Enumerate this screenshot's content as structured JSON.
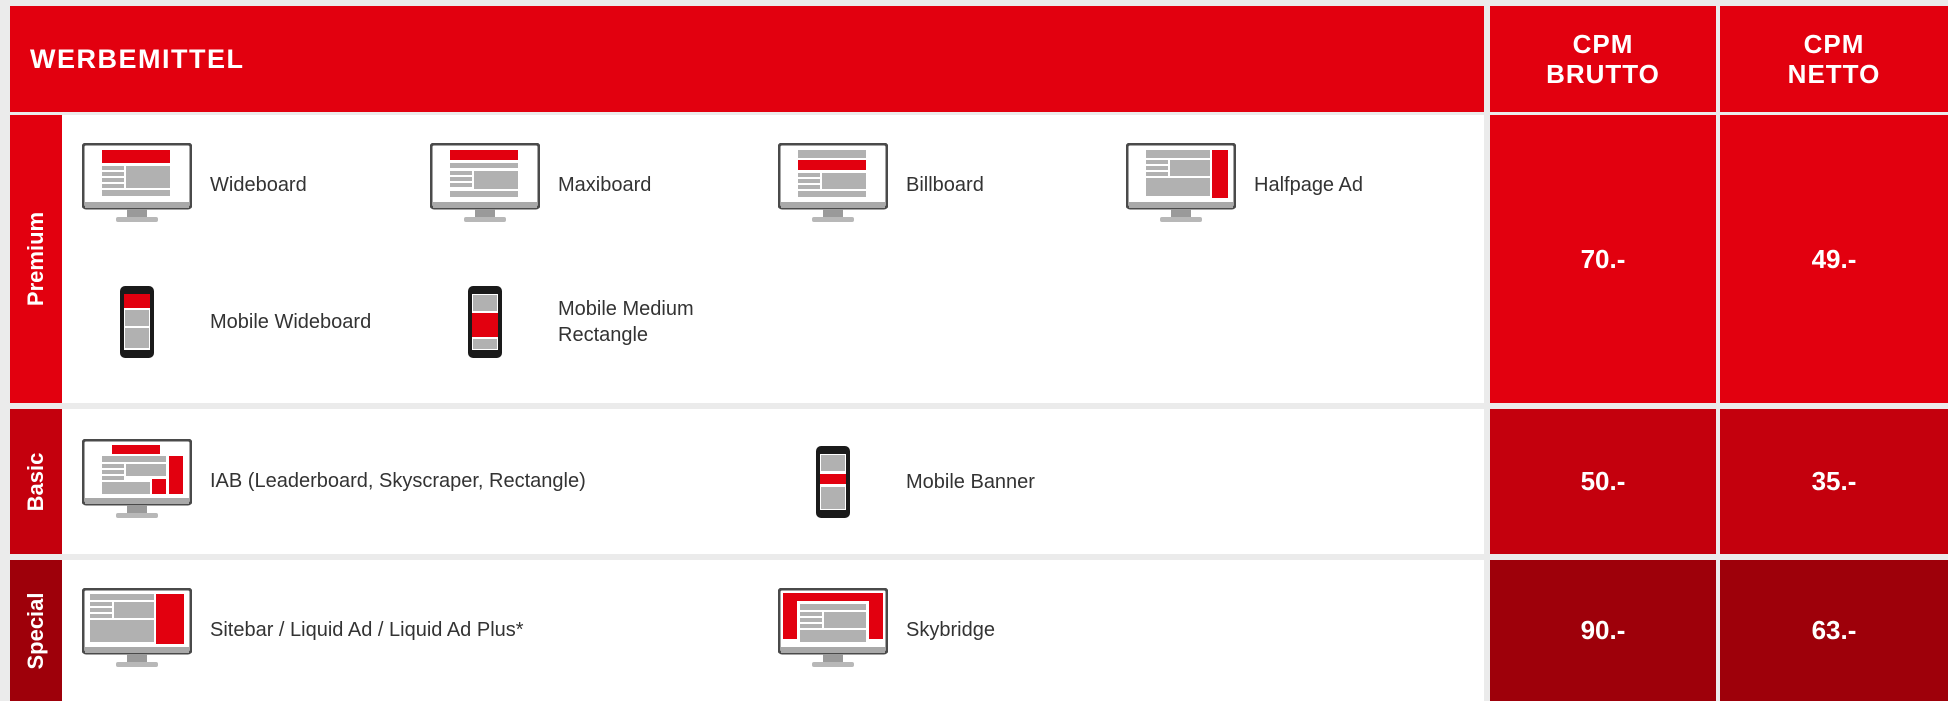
{
  "header": {
    "title": "WERBEMITTEL",
    "brutto": [
      "CPM",
      "BRUTTO"
    ],
    "netto": [
      "CPM",
      "NETTO"
    ]
  },
  "colors": {
    "header": "#e2000f",
    "premium": "#e2000f",
    "basic": "#c4000d",
    "special": "#9e000a",
    "ad_red": "#e2000f",
    "ad_gray": "#b1b1b1"
  },
  "rows": [
    {
      "category": "Premium",
      "brutto": "70.-",
      "netto": "49.-",
      "items": [
        {
          "label": "Wideboard",
          "icon": "desktop-wideboard-icon"
        },
        {
          "label": "Maxiboard",
          "icon": "desktop-maxiboard-icon"
        },
        {
          "label": "Billboard",
          "icon": "desktop-billboard-icon"
        },
        {
          "label": "Halfpage Ad",
          "icon": "desktop-halfpage-icon"
        },
        {
          "label": "Mobile Wideboard",
          "icon": "mobile-wideboard-icon"
        },
        {
          "label": "Mobile Medium Rectangle",
          "icon": "mobile-medium-rectangle-icon"
        }
      ]
    },
    {
      "category": "Basic",
      "brutto": "50.-",
      "netto": "35.-",
      "items": [
        {
          "label": "IAB (Leaderboard, Skyscraper, Rectangle)",
          "icon": "desktop-iab-icon"
        },
        {
          "label": "Mobile Banner",
          "icon": "mobile-banner-icon"
        }
      ]
    },
    {
      "category": "Special",
      "brutto": "90.-",
      "netto": "63.-",
      "items": [
        {
          "label": "Sitebar / Liquid Ad / Liquid Ad Plus*",
          "icon": "desktop-sitebar-icon"
        },
        {
          "label": "Skybridge",
          "icon": "desktop-skybridge-icon"
        }
      ]
    }
  ]
}
